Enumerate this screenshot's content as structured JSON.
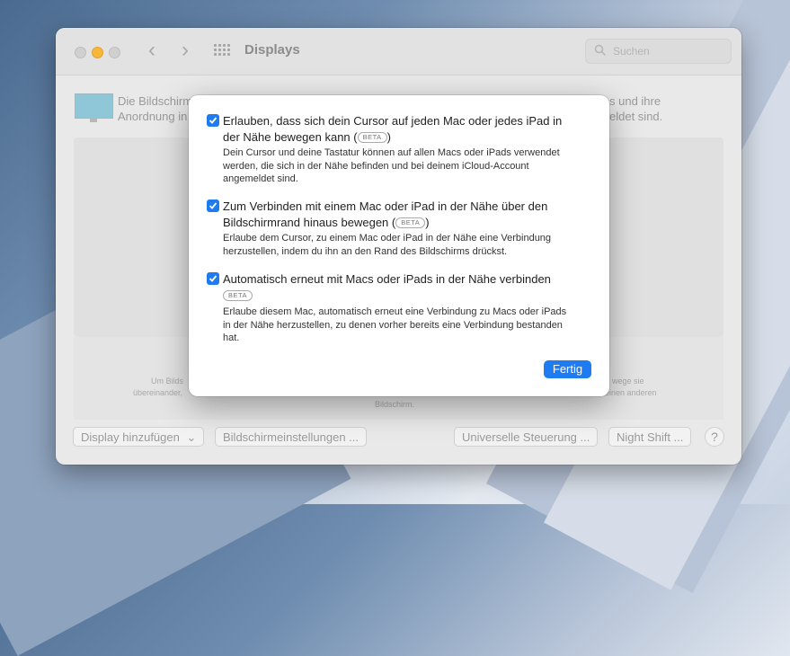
{
  "window": {
    "title": "Displays",
    "search_placeholder": "Suchen",
    "back_glyph": "‹",
    "forward_glyph": "›",
    "description_left_1": "Die Bildschirm",
    "description_left_2": "Anordnung in",
    "description_right_1": "s und ihre",
    "description_right_2": "eldet sind.",
    "arrangement_hint_left_1": "Um Bilds",
    "arrangement_hint_left_2": "übereinander,",
    "arrangement_hint_right_1": "wege sie",
    "arrangement_hint_right_2": "einen anderen",
    "arrangement_hint_bottom": "Bildschirm."
  },
  "footer": {
    "add_display": "Display hinzufügen",
    "add_display_chevron": "⌄",
    "display_settings": "Bildschirmeinstellungen ...",
    "universal_control": "Universelle Steuerung ...",
    "night_shift": "Night Shift ...",
    "help": "?"
  },
  "dialog": {
    "options": [
      {
        "checked": true,
        "title_line1": "Erlauben, dass sich dein Cursor auf jeden Mac oder jedes iPad in",
        "title_line2_before": "der Nähe bewegen kann (",
        "title_line2_after": ")",
        "badge": "BETA",
        "description": [
          "Dein Cursor und deine Tastatur können auf allen Macs oder iPads verwendet",
          "werden, die sich in der Nähe befinden und bei deinem iCloud-Account",
          "angemeldet sind."
        ]
      },
      {
        "checked": true,
        "title_line1": "Zum Verbinden mit einem Mac oder iPad in der Nähe über den",
        "title_line2_before": "Bildschirmrand hinaus bewegen (",
        "title_line2_after": ")",
        "badge": "BETA",
        "description": [
          "Erlaube dem Cursor, zu einem Mac oder iPad in der Nähe eine Verbindung",
          "herzustellen, indem du ihn an den Rand des Bildschirms drückst."
        ]
      },
      {
        "checked": true,
        "title_line1": "Automatisch erneut mit Macs oder iPads in der Nähe verbinden",
        "badge": "BETA",
        "description": [
          "Erlaube diesem Mac, automatisch erneut eine Verbindung zu Macs oder iPads",
          "in der Nähe herzustellen, zu denen vorher bereits eine Verbindung bestanden",
          "hat."
        ]
      }
    ],
    "done_button": "Fertig"
  },
  "colors": {
    "accent": "#1f7bf0",
    "traffic_minimize": "#f6b73c"
  }
}
